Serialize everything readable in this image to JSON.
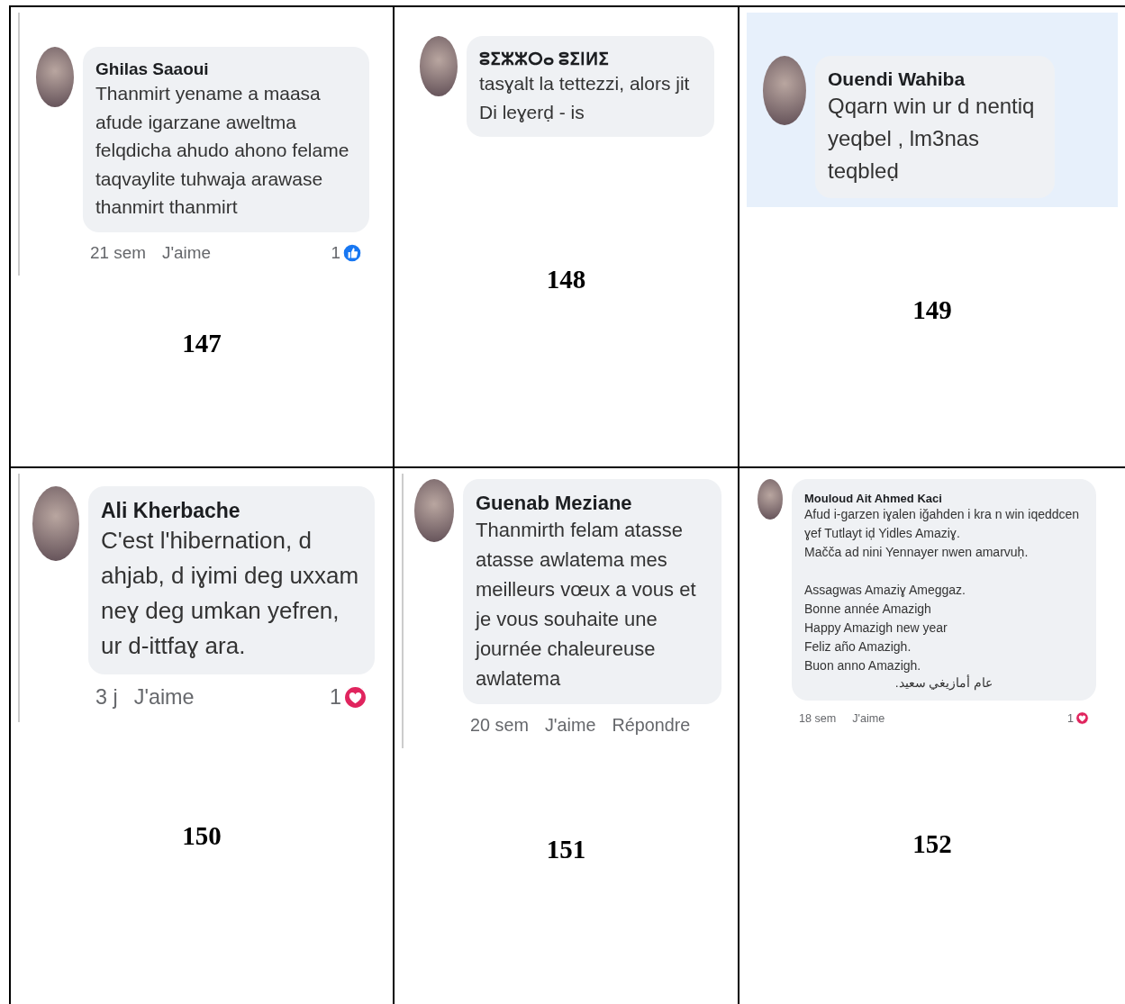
{
  "cells": [
    {
      "number": "147",
      "comment": {
        "author": "Ghilas Saaoui",
        "text": "Thanmirt yename a maasa afude igarzane aweltma felqdicha ahudo ahono felame taqvaylite tuhwaja arawase thanmirt thanmirt",
        "time": "21 sem",
        "like_label": "J'aime",
        "reaction": {
          "kind": "like",
          "count": "1"
        }
      }
    },
    {
      "number": "148",
      "comment": {
        "author": "ⵓⵉⵣⵣⵔⴰ ⵓⵉⵏⵍⵉ",
        "text": "tasɣalt la tettezzi, alors jit Di leɣerḍ - is"
      }
    },
    {
      "number": "149",
      "comment": {
        "author": "Ouendi Wahiba",
        "text": "Qqarn win ur d nentiq yeqbel , lm3nas teqbleḍ"
      }
    },
    {
      "number": "150",
      "comment": {
        "author": "Ali Kherbache",
        "text": "C'est l'hibernation, d ahjab, d iɣimi deg uxxam neɣ deg umkan yefren, ur d-ittfaɣ ara.",
        "time": "3 j",
        "like_label": "J'aime",
        "reaction": {
          "kind": "love",
          "count": "1"
        }
      }
    },
    {
      "number": "151",
      "comment": {
        "author": "Guenab Meziane",
        "text": "Thanmirth felam atasse atasse awlatema mes meilleurs vœux a vous et je vous souhaite une journée chaleureuse awlatema",
        "time": "20 sem",
        "like_label": "J'aime",
        "reply_label": "Répondre"
      }
    },
    {
      "number": "152",
      "comment": {
        "author": "Mouloud Ait Ahmed Kaci",
        "text": "Afud i-garzen iɣalen iğahden i kra n win iqeddcen ɣef Tutlayt iḍ Yidles Amaziɣ.\nMačča ad nini Yennayer nwen amarvuḥ.\n\nAssagwas Amaziɣ Ameggaz.\nBonne année Amazigh\nHappy Amazigh new year\nFeliz año Amazigh.\nBuon anno Amazigh.",
        "rtl_line": "عام أمازيغي سعيد.",
        "time": "18 sem",
        "like_label": "J'aime",
        "reaction": {
          "kind": "love",
          "count": "1"
        }
      }
    }
  ]
}
